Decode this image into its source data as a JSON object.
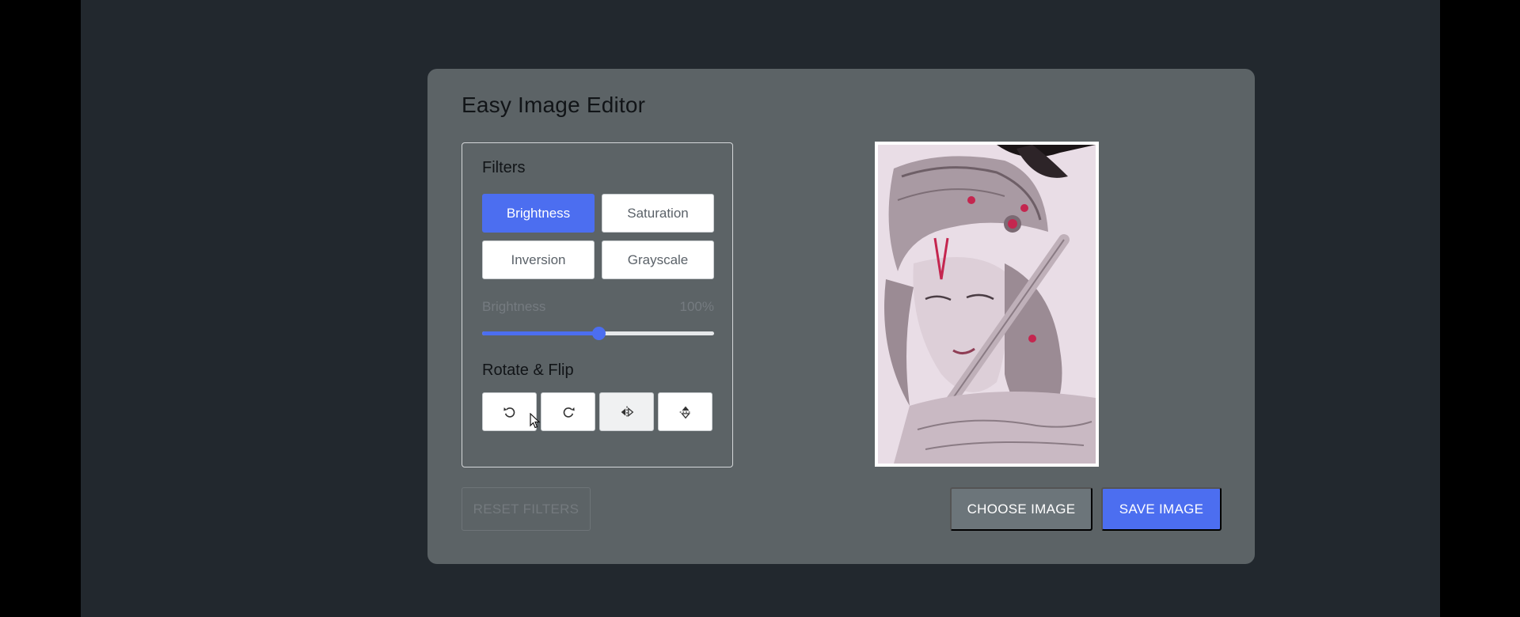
{
  "app": {
    "title": "Easy Image Editor"
  },
  "filters": {
    "heading": "Filters",
    "buttons": [
      {
        "label": "Brightness",
        "active": true
      },
      {
        "label": "Saturation",
        "active": false
      },
      {
        "label": "Inversion",
        "active": false
      },
      {
        "label": "Grayscale",
        "active": false
      }
    ],
    "slider": {
      "name": "Brightness",
      "value_text": "100%",
      "position_fraction": 0.5
    }
  },
  "rotate_flip": {
    "heading": "Rotate & Flip",
    "buttons": [
      {
        "icon": "rotate-left-icon"
      },
      {
        "icon": "rotate-right-icon"
      },
      {
        "icon": "flip-horizontal-icon"
      },
      {
        "icon": "flip-vertical-icon"
      }
    ]
  },
  "actions": {
    "reset_label": "RESET FILTERS",
    "choose_label": "CHOOSE IMAGE",
    "save_label": "SAVE IMAGE"
  },
  "colors": {
    "accent": "#4c6ef0",
    "card_bg": "#5c6366",
    "page_bg": "#22282e"
  }
}
